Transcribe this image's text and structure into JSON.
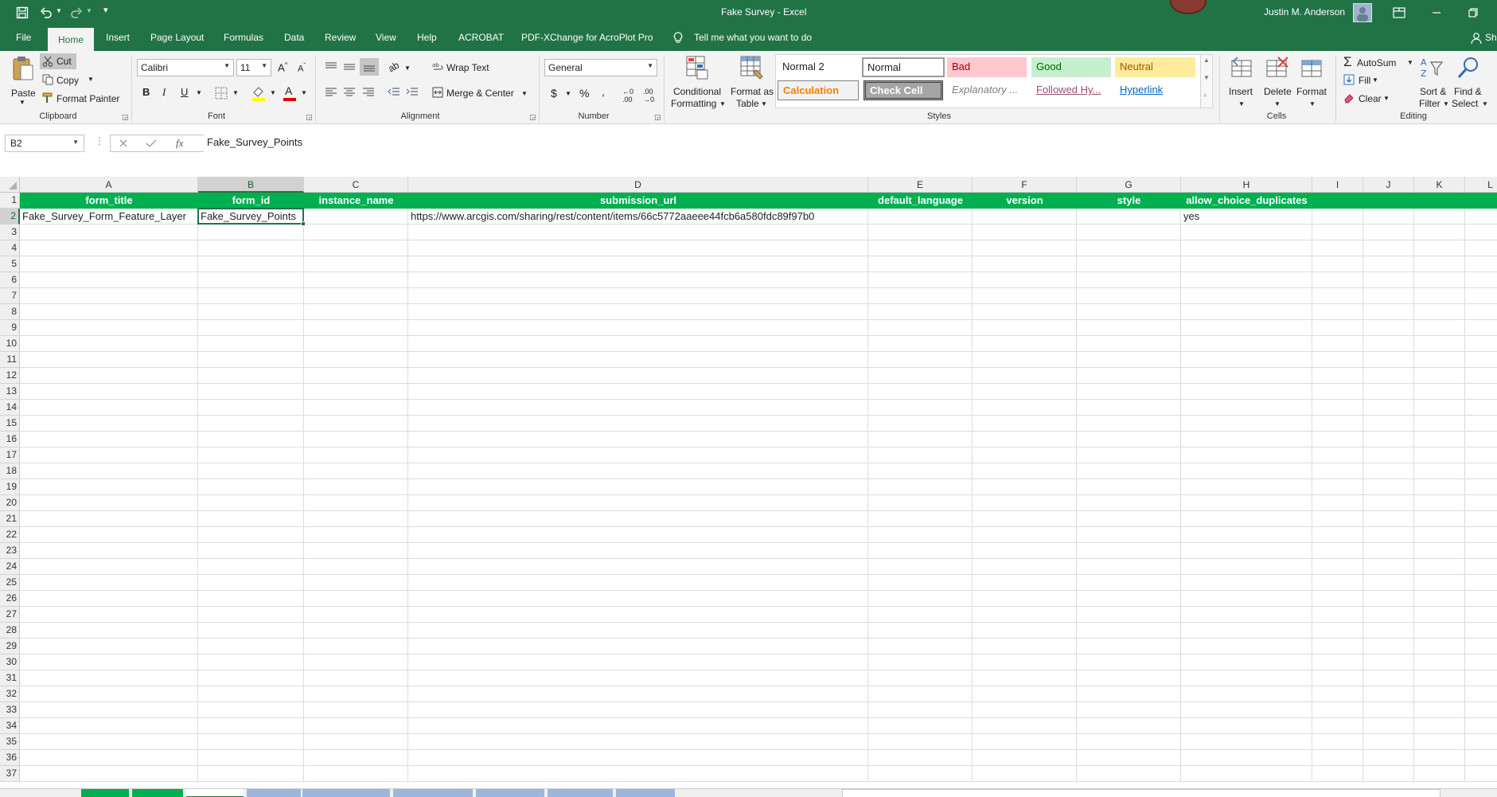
{
  "window": {
    "title": "Fake Survey  -  Excel",
    "user_name": "Justin M. Anderson"
  },
  "quick_access": {
    "save_icon": "save-icon",
    "undo_icon": "undo-icon",
    "redo_icon": "redo-icon"
  },
  "ribbon_tabs": [
    {
      "label": "File"
    },
    {
      "label": "Home"
    },
    {
      "label": "Insert"
    },
    {
      "label": "Page Layout"
    },
    {
      "label": "Formulas"
    },
    {
      "label": "Data"
    },
    {
      "label": "Review"
    },
    {
      "label": "View"
    },
    {
      "label": "Help"
    },
    {
      "label": "ACROBAT"
    },
    {
      "label": "PDF-XChange for AcroPlot Pro"
    }
  ],
  "tell_me": "Tell me what you want to do",
  "share_label": "Sh",
  "clipboard": {
    "paste": "Paste",
    "cut": "Cut",
    "copy": "Copy",
    "format_painter": "Format Painter",
    "label": "Clipboard"
  },
  "font": {
    "name": "Calibri",
    "size": "11",
    "label": "Font"
  },
  "alignment": {
    "wrap_text": "Wrap Text",
    "merge_center": "Merge & Center",
    "label": "Alignment"
  },
  "number": {
    "format": "General",
    "label": "Number"
  },
  "styles": {
    "conditional_formatting": [
      "Conditional",
      "Formatting"
    ],
    "format_as_table": [
      "Format as",
      "Table"
    ],
    "gallery": [
      {
        "label": "Normal 2"
      },
      {
        "label": "Normal"
      },
      {
        "label": "Bad"
      },
      {
        "label": "Good"
      },
      {
        "label": "Neutral"
      },
      {
        "label": "Calculation"
      },
      {
        "label": "Check Cell"
      },
      {
        "label": "Explanatory ..."
      },
      {
        "label": "Followed Hy..."
      },
      {
        "label": "Hyperlink"
      }
    ],
    "label": "Styles"
  },
  "cells_group": {
    "insert": "Insert",
    "delete": "Delete",
    "format": "Format",
    "label": "Cells"
  },
  "editing": {
    "autosum": "AutoSum",
    "fill": "Fill",
    "clear": "Clear",
    "sort_filter": [
      "Sort &",
      "Filter"
    ],
    "find_select": [
      "Find &",
      "Select"
    ],
    "label": "Editing"
  },
  "formula_bar": {
    "name_box": "B2",
    "fx": "fx",
    "content": "Fake_Survey_Points"
  },
  "sheet": {
    "columns": [
      "A",
      "B",
      "C",
      "D",
      "E",
      "F",
      "G",
      "H",
      "I",
      "J",
      "K",
      "L"
    ],
    "header_row": [
      "form_title",
      "form_id",
      "instance_name",
      "submission_url",
      "default_language",
      "version",
      "style",
      "allow_choice_duplicates",
      "",
      "",
      "",
      ""
    ],
    "row2": [
      "Fake_Survey_Form_Feature_Layer",
      "Fake_Survey_Points",
      "",
      "https://www.arcgis.com/sharing/rest/content/items/66c5772aaeee44fcb6a580fdc89f97b0",
      "",
      "",
      "",
      "yes",
      "",
      "",
      "",
      ""
    ],
    "row_numbers": [
      "1",
      "2",
      "3",
      "4",
      "5",
      "6",
      "7",
      "8",
      "9",
      "10",
      "11",
      "12",
      "13",
      "14",
      "15",
      "16",
      "17",
      "18",
      "19",
      "20",
      "21",
      "22",
      "23",
      "24",
      "25",
      "26",
      "27",
      "28",
      "29",
      "30",
      "31",
      "32",
      "33",
      "34",
      "35",
      "36",
      "37"
    ],
    "header_color": "#00B050",
    "selected_cell": "B2"
  },
  "colors": {
    "excel_green": "#217346",
    "header_green": "#00B050"
  }
}
